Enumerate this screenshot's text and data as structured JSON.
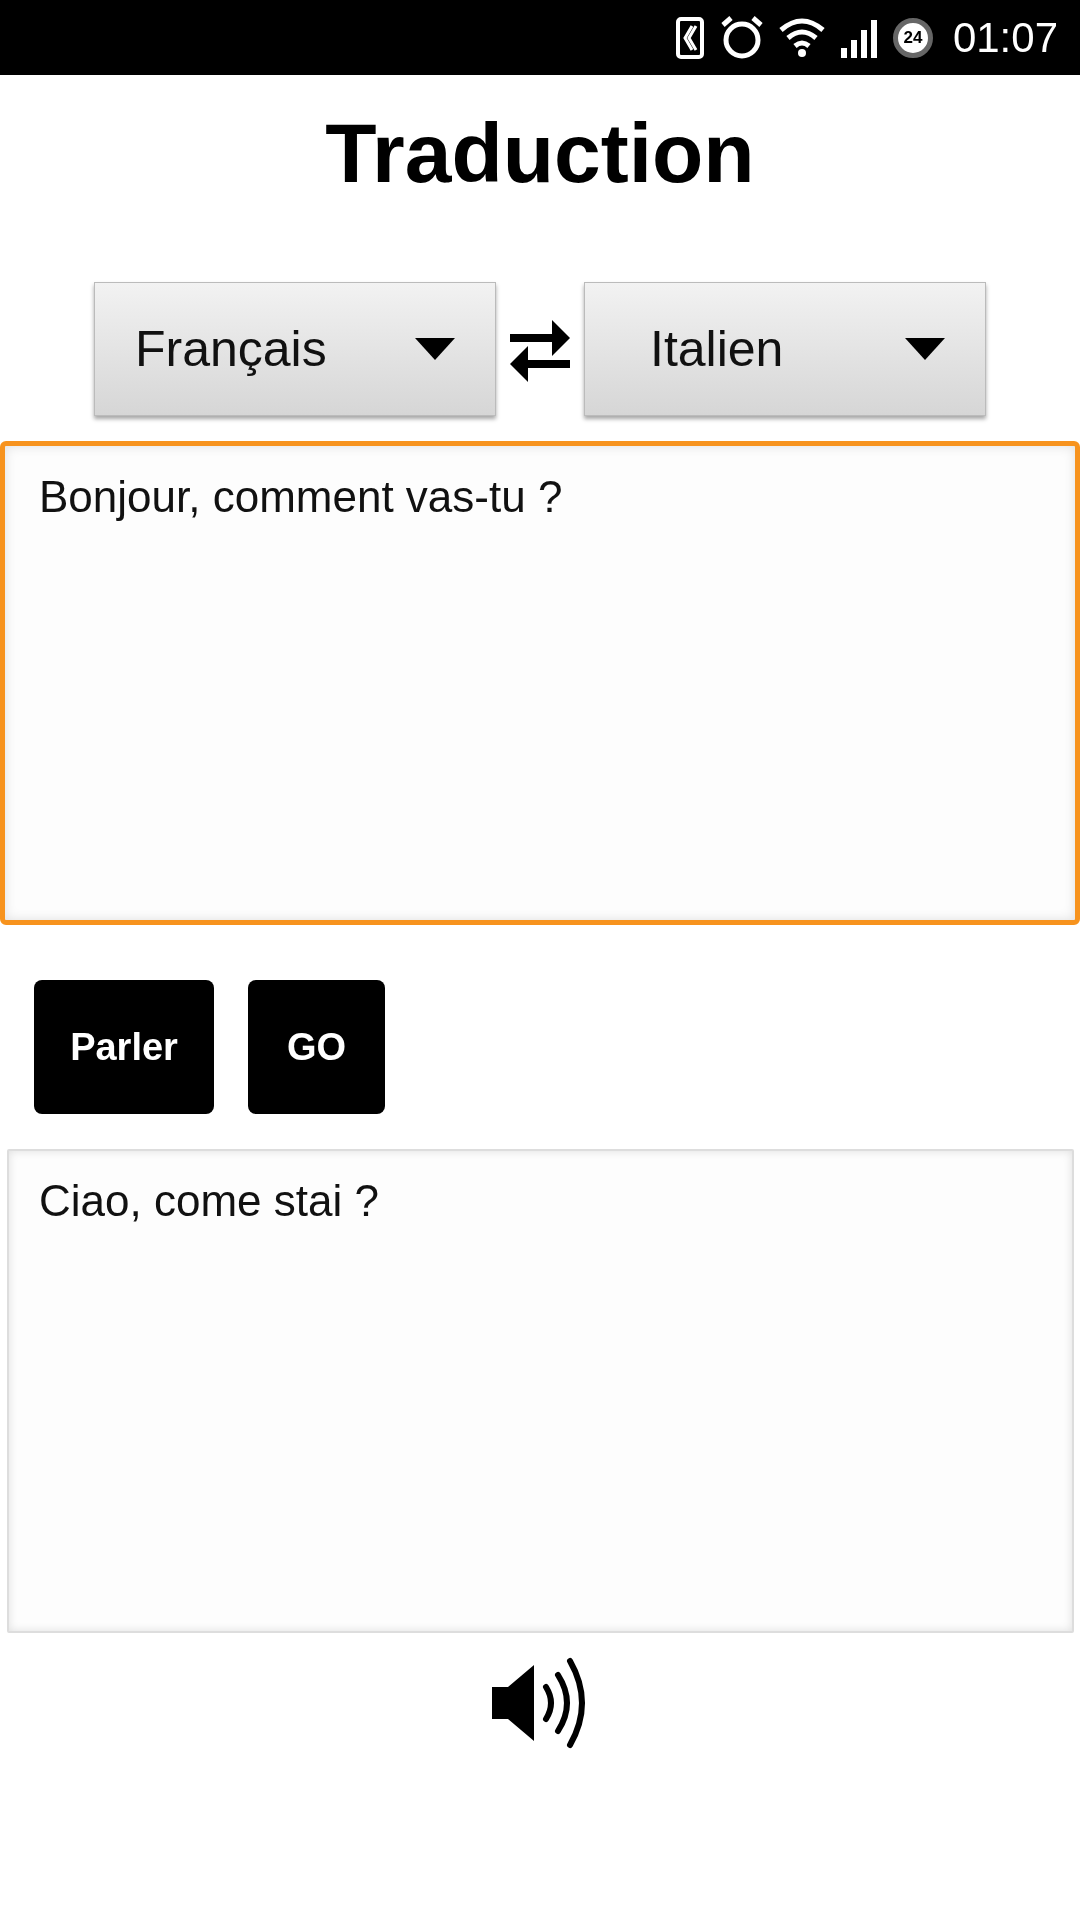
{
  "status_bar": {
    "badge": "24",
    "time": "01:07"
  },
  "title": "Traduction",
  "languages": [
    {
      "value": "Français"
    },
    {
      "value": "Italien"
    }
  ],
  "input": {
    "value": "Bonjour, comment vas-tu ?",
    "focused": true
  },
  "buttons": [
    "Parler",
    "GO"
  ],
  "output": {
    "value": "Ciao, come stai ?"
  }
}
